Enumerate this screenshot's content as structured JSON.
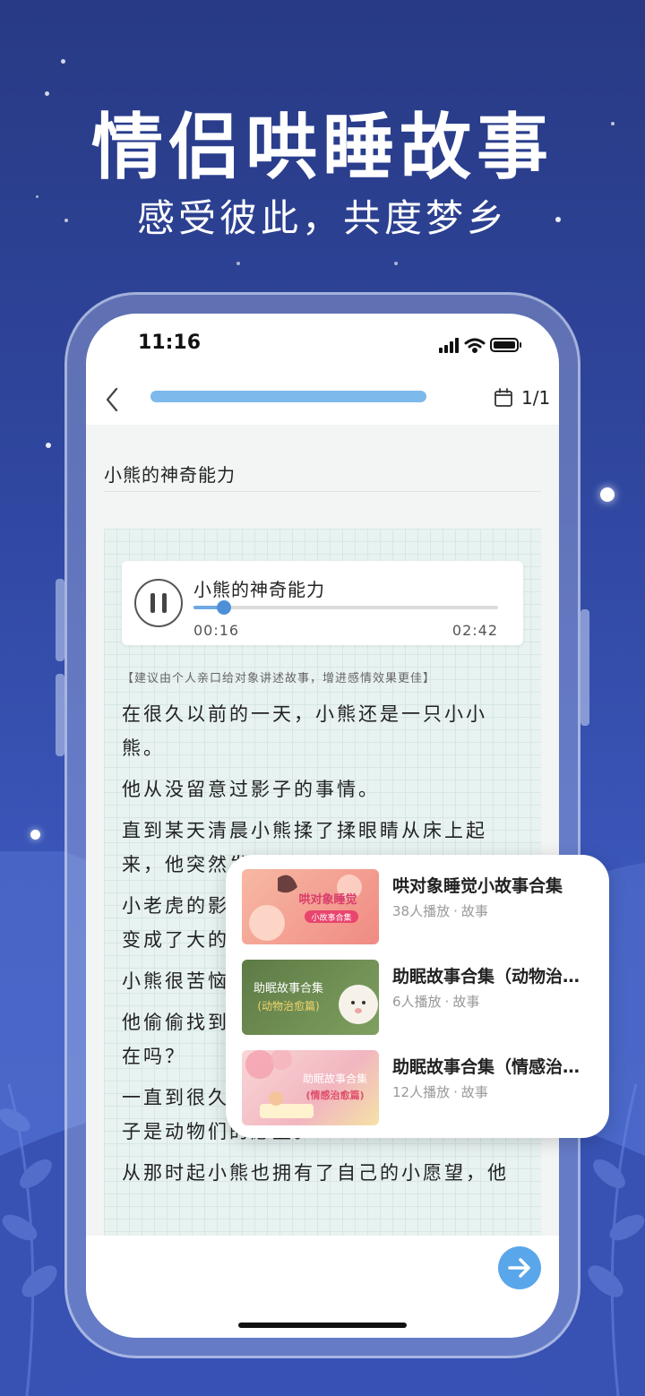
{
  "hero": {
    "title": "情侣哄睡故事",
    "subtitle": "感受彼此，共度梦乡"
  },
  "status_bar": {
    "time": "11:16"
  },
  "top_bar": {
    "reading_progress_percent": 100,
    "page_counter": "1/1"
  },
  "story": {
    "title": "小熊的神奇能力",
    "hint": "【建议由个人亲口给对象讲述故事，增进感情效果更佳】",
    "paragraphs": [
      "在很久以前的一天，小熊还是一只小小熊。",
      "他从没留意过影子的事情。",
      "直到某天清晨小熊揉了揉眼睛从床上起来，他突然发现地上的影子都不见了。",
      "小老虎的影子变成了蛋糕，小兔子的影子变成了大的房子。",
      "小熊很苦恼。",
      "他偷偷找到了小狐狸，问它看到的影子还在吗？",
      "一直到很久以后小熊才发现，原来那些影子是动物们的愿望。",
      "从那时起小熊也拥有了自己的小愿望，他"
    ]
  },
  "player": {
    "title": "小熊的神奇能力",
    "current_time": "00:16",
    "total_time": "02:42",
    "progress_fraction": 0.099
  },
  "recommendations": [
    {
      "title": "哄对象睡觉小故事合集",
      "plays": "38人播放",
      "category": "故事",
      "thumb_text_main": "哄对象睡觉",
      "thumb_text_sub": "小故事合集"
    },
    {
      "title": "助眠故事合集（动物治愈篇）",
      "plays": "6人播放",
      "category": "故事",
      "thumb_text_main": "助眠故事合集",
      "thumb_text_sub": "(动物治愈篇)"
    },
    {
      "title": "助眠故事合集（情感治愈篇）",
      "plays": "12人播放",
      "category": "故事",
      "thumb_text_main": "助眠故事合集",
      "thumb_text_sub": "(情感治愈篇)"
    }
  ],
  "colors": {
    "background_top": "#283a84",
    "accent_blue": "#5aa6ea",
    "progress_fill": "#7db9ea",
    "grid_paper": "#e8f3f1"
  },
  "icons": {
    "back": "chevron-left-icon",
    "calendar": "calendar-icon",
    "pause": "pause-icon",
    "next": "arrow-right-icon",
    "signal": "signal-icon",
    "wifi": "wifi-icon",
    "battery": "battery-icon"
  }
}
